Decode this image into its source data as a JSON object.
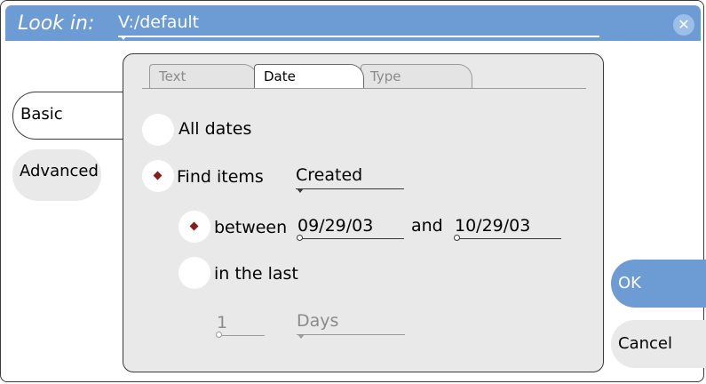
{
  "header": {
    "look_in_label": "Look in:",
    "path": "V:/default"
  },
  "sidebar": {
    "items": [
      {
        "label": "Basic"
      },
      {
        "label": "Advanced"
      }
    ]
  },
  "tabs": [
    {
      "label": "Text"
    },
    {
      "label": "Date"
    },
    {
      "label": "Type"
    }
  ],
  "date": {
    "all_dates_label": "All dates",
    "find_items_label": "Find items",
    "find_items_value": "Created",
    "between_label": "between",
    "from_date": "09/29/03",
    "and_label": "and",
    "to_date": "10/29/03",
    "in_the_last_label": "in the last",
    "last_count": "1",
    "last_unit": "Days"
  },
  "buttons": {
    "ok": "OK",
    "cancel": "Cancel"
  },
  "colors": {
    "titlebar": "#6d9bd3",
    "panel": "#e9e9e9",
    "radio_dot": "#8b1a1a"
  }
}
